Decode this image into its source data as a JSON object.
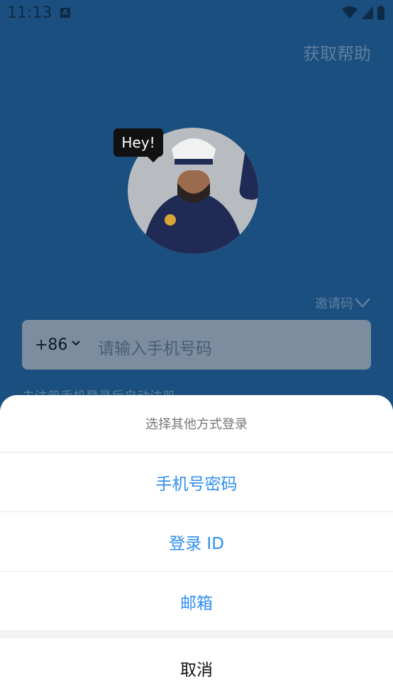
{
  "status_bar": {
    "time": "11:13",
    "notification_icon": "A"
  },
  "header": {
    "help_link": "获取帮助"
  },
  "hero": {
    "bubble_text": "Hey!"
  },
  "invite": {
    "label": "邀请码"
  },
  "phone_input": {
    "country_code": "+86",
    "placeholder": "请输入手机号码"
  },
  "hint": {
    "text": "未注册手机登录后自动注册"
  },
  "sheet": {
    "title": "选择其他方式登录",
    "options": [
      {
        "label": "手机号密码"
      },
      {
        "label": "登录 ID"
      },
      {
        "label": "邮箱"
      }
    ],
    "cancel": "取消"
  },
  "colors": {
    "accent": "#2d8ef2",
    "overlay_bg": "#1b4f7f"
  }
}
